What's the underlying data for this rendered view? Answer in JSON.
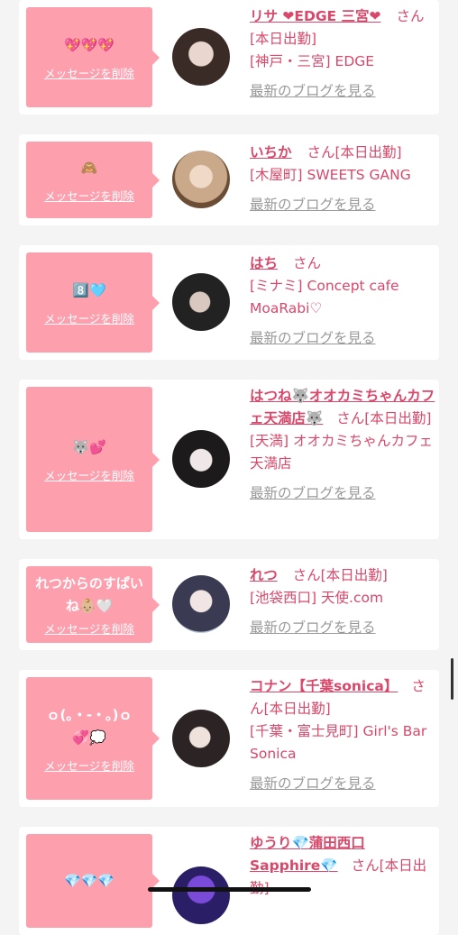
{
  "delete_label": "メッセージを削除",
  "blog_label": "最新のブログを見る",
  "san_label": "さん",
  "cards": [
    {
      "message": "💖💖💖",
      "name": "リサ ❤EDGE 三宮❤",
      "status": "[本日出勤]",
      "place": "[神戸・三宮] EDGE"
    },
    {
      "message": "🙈",
      "name": "いちか",
      "status": "[本日出勤]",
      "place": "[木屋町] SWEETS GANG"
    },
    {
      "message": "8️⃣🩵",
      "name": "はち",
      "status": "",
      "place": "[ミナミ] Concept cafe MoaRabi♡"
    },
    {
      "message": "🐺💕",
      "name": "はつね🐺オオカミちゃんカフェ天満店🐺",
      "status": "[本日出勤]",
      "place": "[天満] オオカミちゃんカフェ天満店"
    },
    {
      "message": "れつからのすぱいね👶🏼🤍",
      "name": "れつ",
      "status": "[本日出勤]",
      "place": "[池袋西口] 天使.com"
    },
    {
      "message": "ｏ(｡・-・｡)ｏ💞💭",
      "name": "コナン【千葉sonica】",
      "status": "[本日出勤]",
      "place": "[千葉・富士見町] Girl's Bar Sonica"
    },
    {
      "message": "💎💎💎",
      "name": "ゆうり💎蒲田西口Sapphire💎",
      "status": "[本日出勤]",
      "place": ""
    }
  ]
}
